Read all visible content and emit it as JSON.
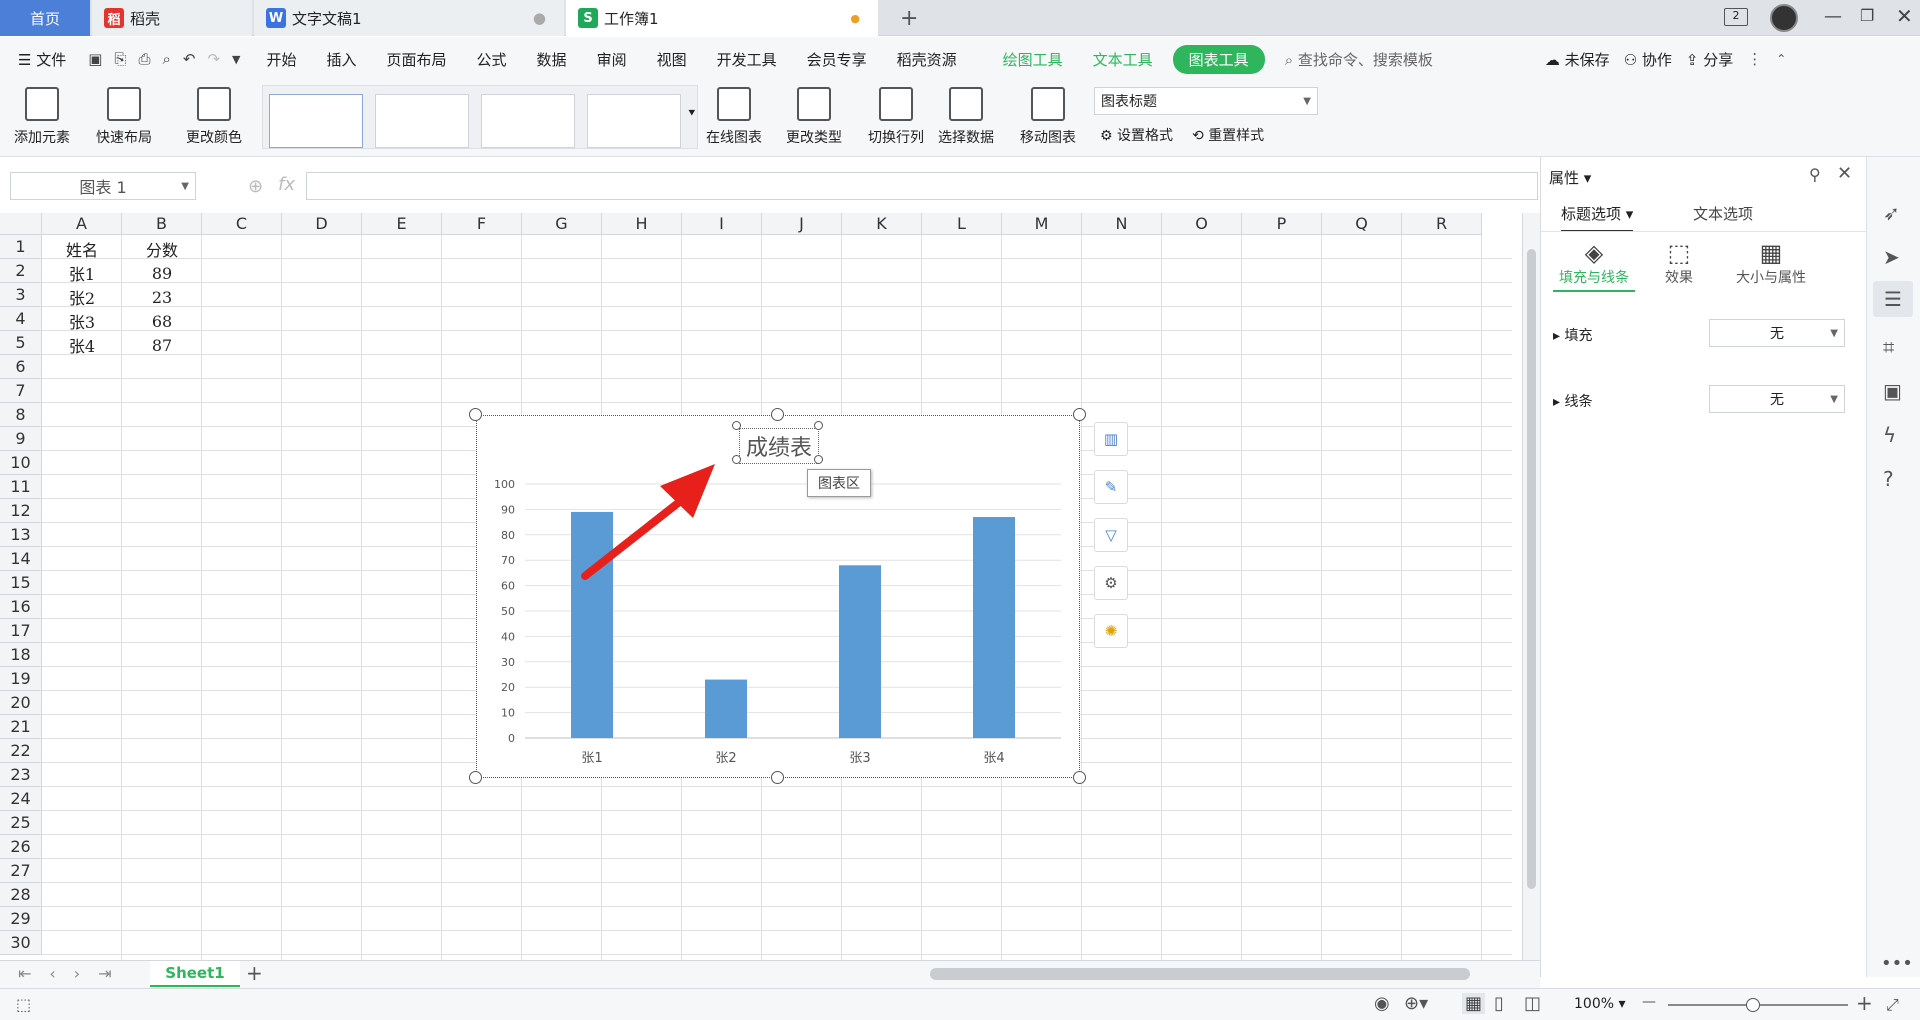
{
  "tabs": {
    "home": "首页",
    "daoke": "稻壳",
    "doc": "文字文稿1",
    "book": "工作簿1",
    "add": "+"
  },
  "menu": {
    "file": "文件",
    "items": [
      "开始",
      "插入",
      "页面布局",
      "公式",
      "数据",
      "审阅",
      "视图",
      "开发工具",
      "会员专享",
      "稻壳资源"
    ],
    "draw_tools": "绘图工具",
    "text_tools": "文本工具",
    "chart_tools": "图表工具",
    "search": "查找命令、搜索模板",
    "unsaved": "未保存",
    "collab": "协作",
    "share": "分享"
  },
  "ribbon": {
    "add_element": "添加元素",
    "quick_layout": "快速布局",
    "change_color": "更改颜色",
    "online_chart": "在线图表",
    "change_type": "更改类型",
    "switch_rowcol": "切换行列",
    "select_data": "选择数据",
    "move_chart": "移动图表",
    "element_select": "图表标题",
    "set_format": "设置格式",
    "reset_style": "重置样式"
  },
  "namebox": "图表 1",
  "fx": "fx",
  "columns": [
    "A",
    "B",
    "C",
    "D",
    "E",
    "F",
    "G",
    "H",
    "I",
    "J",
    "K",
    "L",
    "M",
    "N",
    "O",
    "P",
    "Q",
    "R"
  ],
  "rows": [
    "1",
    "2",
    "3",
    "4",
    "5",
    "6",
    "7",
    "8",
    "9",
    "10",
    "11",
    "12",
    "13",
    "14",
    "15",
    "16",
    "17",
    "18",
    "19",
    "20",
    "21",
    "22",
    "23",
    "24",
    "25",
    "26",
    "27",
    "28",
    "29",
    "30"
  ],
  "cells": {
    "a1": "姓名",
    "b1": "分数",
    "a2": "张1",
    "b2": "89",
    "a3": "张2",
    "b3": "23",
    "a4": "张3",
    "b4": "68",
    "a5": "张4",
    "b5": "87"
  },
  "chart_tooltip": "图表区",
  "chart_data": {
    "type": "bar",
    "title": "成绩表",
    "categories": [
      "张1",
      "张2",
      "张3",
      "张4"
    ],
    "values": [
      89,
      23,
      68,
      87
    ],
    "ylim": [
      0,
      100
    ],
    "yticks": [
      "0",
      "10",
      "20",
      "30",
      "40",
      "50",
      "60",
      "70",
      "80",
      "90",
      "100"
    ],
    "grid": true,
    "color": "#5b9bd5"
  },
  "panel": {
    "title": "属性",
    "tab1": "标题选项",
    "tab2": "文本选项",
    "sub1": "填充与线条",
    "sub2": "效果",
    "sub3": "大小与属性",
    "fill_label": "填充",
    "fill_value": "无",
    "line_label": "线条",
    "line_value": "无"
  },
  "sheet": {
    "name": "Sheet1",
    "add": "+"
  },
  "status": {
    "zoom": "100%",
    "minus": "—",
    "plus": "+"
  },
  "accent_green": "#2fb65d"
}
